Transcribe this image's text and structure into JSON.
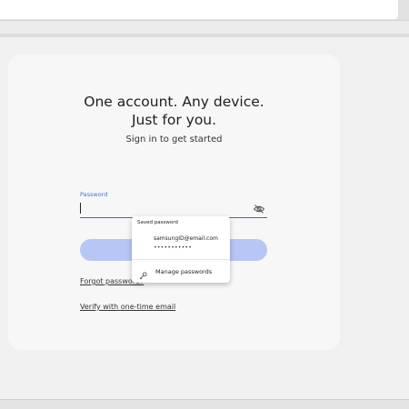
{
  "headline": {
    "line1": "One account. Any device.",
    "line2": "Just for you."
  },
  "subtitle": "Sign in to get started",
  "password_field": {
    "label": "Password",
    "value": ""
  },
  "icons": {
    "visibility_toggle": "eye-off-icon",
    "manage": "key-icon"
  },
  "links": {
    "forgot_password": "Forgot password?",
    "verify": "Verify with one-time email"
  },
  "autofill_popup": {
    "title": "Saved password",
    "email": "samsungID@email.com",
    "masked_password": "•••••••••••",
    "manage_label": "Manage passwords"
  },
  "colors": {
    "accent": "#3a66d9",
    "button_disabled": "#b7c6f5",
    "card_bg": "#f7f7f7",
    "page_bg": "#f0f0f0"
  }
}
